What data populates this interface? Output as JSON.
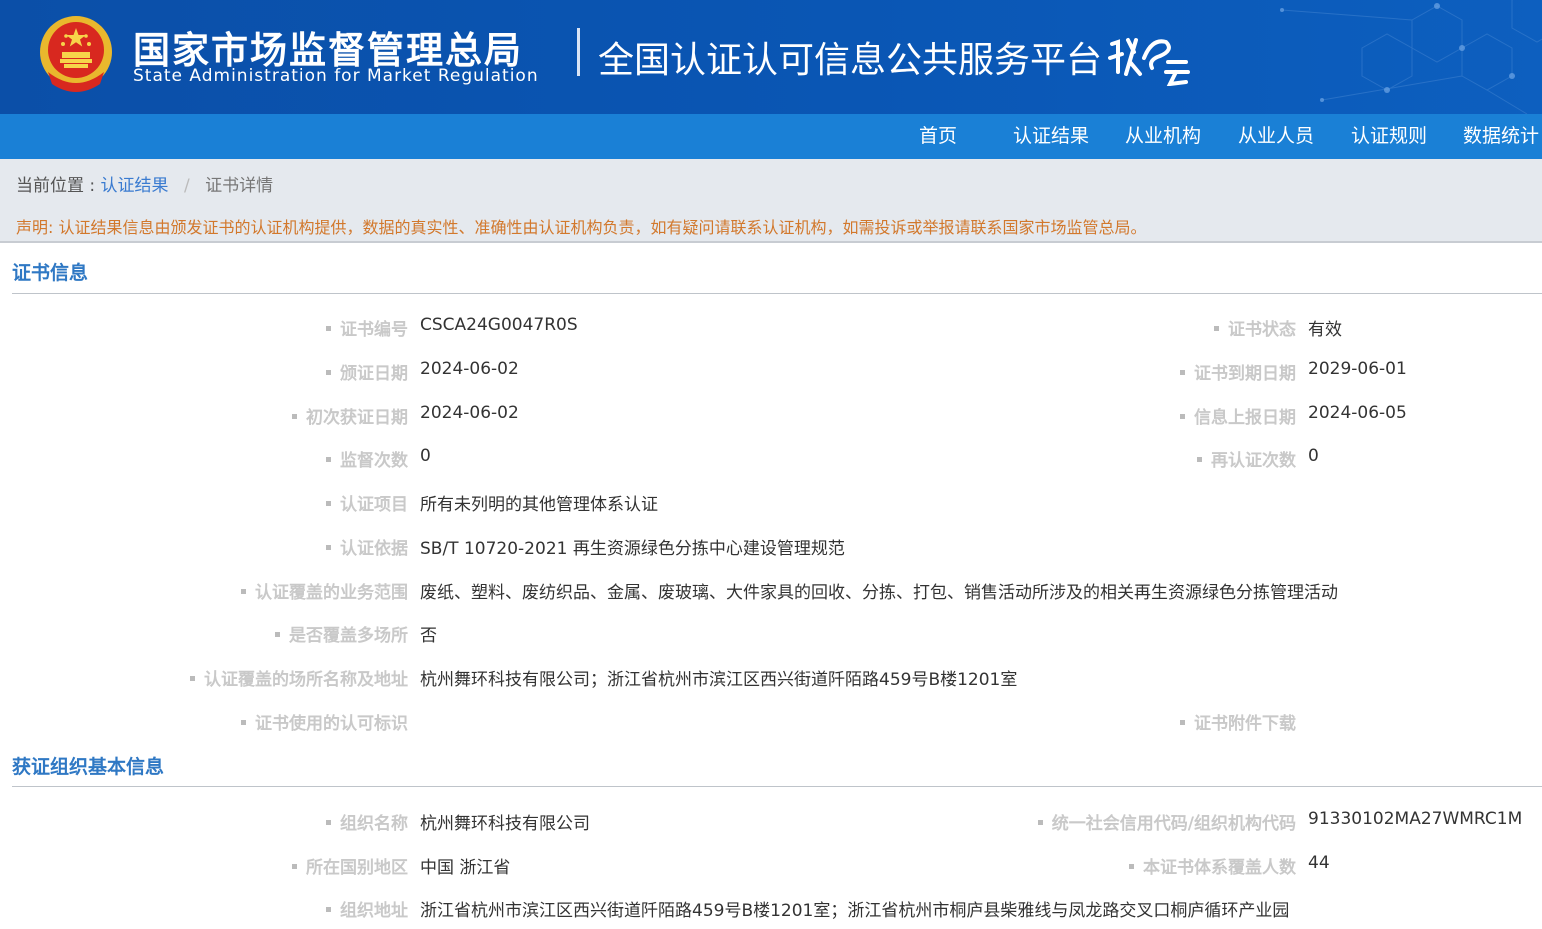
{
  "header": {
    "title_cn": "国家市场监督管理总局",
    "title_en": "State Administration  for  Market Regulation",
    "platform": "全国认证认可信息公共服务平台",
    "logo_text": "认e云",
    "colors": {
      "header_bg": "#0b4fa8",
      "nav_bg": "#1a80d6",
      "section_title": "#2f78c4",
      "notice": "#d2782c"
    }
  },
  "nav": {
    "items": [
      "首页",
      "认证结果",
      "从业机构",
      "从业人员",
      "认证规则",
      "数据统计"
    ]
  },
  "breadcrumb": {
    "prefix": "当前位置 :",
    "link": "认证结果",
    "separator": "/",
    "current": "证书详情"
  },
  "notice": "声明: 认证结果信息由颁发证书的认证机构提供，数据的真实性、准确性由认证机构负责，如有疑问请联系认证机构，如需投诉或举报请联系国家市场监管总局。",
  "cert": {
    "section_title": "证书信息",
    "number": {
      "label": "证书编号",
      "value": "CSCA24G0047R0S"
    },
    "status": {
      "label": "证书状态",
      "value": "有效"
    },
    "issue_date": {
      "label": "颁证日期",
      "value": "2024-06-02"
    },
    "expiry_date": {
      "label": "证书到期日期",
      "value": "2029-06-01"
    },
    "first_date": {
      "label": "初次获证日期",
      "value": "2024-06-02"
    },
    "report_date": {
      "label": "信息上报日期",
      "value": "2024-06-05"
    },
    "supervision_count": {
      "label": "监督次数",
      "value": "0"
    },
    "recert_count": {
      "label": "再认证次数",
      "value": "0"
    },
    "project": {
      "label": "认证项目",
      "value": "所有未列明的其他管理体系认证"
    },
    "basis": {
      "label": "认证依据",
      "value": "SB/T 10720-2021 再生资源绿色分拣中心建设管理规范"
    },
    "scope": {
      "label": "认证覆盖的业务范围",
      "value": "废纸、塑料、废纺织品、金属、废玻璃、大件家具的回收、分拣、打包、销售活动所涉及的相关再生资源绿色分拣管理活动"
    },
    "multi_site": {
      "label": "是否覆盖多场所",
      "value": "否"
    },
    "site": {
      "label": "认证覆盖的场所名称及地址",
      "value": "杭州舞环科技有限公司；浙江省杭州市滨江区西兴街道阡陌路459号B楼1201室"
    },
    "mark": {
      "label": "证书使用的认可标识"
    },
    "attachment": {
      "label": "证书附件下载"
    }
  },
  "org": {
    "section_title": "获证组织基本信息",
    "name": {
      "label": "组织名称",
      "value": "杭州舞环科技有限公司"
    },
    "credit_code": {
      "label": "统一社会信用代码/组织机构代码",
      "value": "91330102MA27WMRC1M"
    },
    "region": {
      "label": "所在国别地区",
      "value": "中国 浙江省"
    },
    "headcount": {
      "label": "本证书体系覆盖人数",
      "value": "44"
    },
    "address": {
      "label": "组织地址",
      "value": "浙江省杭州市滨江区西兴街道阡陌路459号B楼1201室；浙江省杭州市桐庐县柴雅线与凤龙路交叉口桐庐循环产业园"
    }
  }
}
